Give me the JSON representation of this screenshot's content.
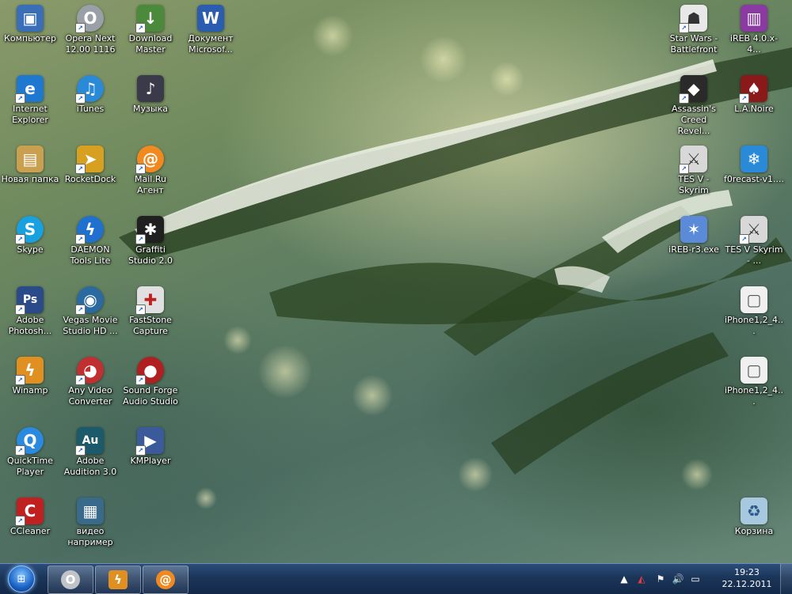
{
  "colors": {
    "taskbar": "#1b3558",
    "icon_label": "#ffffff"
  },
  "desktop_icons": {
    "kompyuter": {
      "label": "Компьютер",
      "icon": "computer-icon",
      "color": "#3a6fb8",
      "glyph": "▣"
    },
    "opera": {
      "label": "Opera Next 12.00 1116",
      "icon": "opera-icon",
      "color": "#9aa0a8",
      "glyph": "O"
    },
    "download_master": {
      "label": "Download Master",
      "icon": "download-master-icon",
      "color": "#4a8a3a",
      "glyph": "↓"
    },
    "document": {
      "label": "Документ Microsof...",
      "icon": "word-document-icon",
      "color": "#2a5db0",
      "glyph": "W"
    },
    "ie": {
      "label": "Internet Explorer",
      "icon": "internet-explorer-icon",
      "color": "#1f78d0",
      "glyph": "e"
    },
    "itunes": {
      "label": "iTunes",
      "icon": "itunes-icon",
      "color": "#2a8ad8",
      "glyph": "♫"
    },
    "muzyka": {
      "label": "Музыка",
      "icon": "music-folder-icon",
      "color": "#3a3a4a",
      "glyph": "♪"
    },
    "novaya_papka": {
      "label": "Новая папка",
      "icon": "folder-icon",
      "color": "#c8a050",
      "glyph": "▤"
    },
    "rocketdock": {
      "label": "RocketDock",
      "icon": "rocketdock-icon",
      "color": "#d8a020",
      "glyph": "➤"
    },
    "mailru": {
      "label": "Mail.Ru Агент",
      "icon": "mailru-agent-icon",
      "color": "#f08a20",
      "glyph": "@"
    },
    "skype": {
      "label": "Skype",
      "icon": "skype-icon",
      "color": "#18a0e0",
      "glyph": "S"
    },
    "daemon": {
      "label": "DAEMON Tools Lite",
      "icon": "daemon-tools-icon",
      "color": "#2070d0",
      "glyph": "ϟ"
    },
    "graffiti": {
      "label": "Graffiti Studio 2.0",
      "icon": "graffiti-studio-icon",
      "color": "#202020",
      "glyph": "✱"
    },
    "photoshop": {
      "label": "Adobe Photosh...",
      "icon": "photoshop-icon",
      "color": "#2a4a8a",
      "glyph": "Ps"
    },
    "vegas": {
      "label": "Vegas Movie Studio HD ...",
      "icon": "vegas-movie-studio-icon",
      "color": "#2a6aa0",
      "glyph": "◉"
    },
    "faststone": {
      "label": "FastStone Capture",
      "icon": "faststone-capture-icon",
      "color": "#e0e0e0",
      "glyph": "✚"
    },
    "winamp": {
      "label": "Winamp",
      "icon": "winamp-icon",
      "color": "#e09020",
      "glyph": "ϟ"
    },
    "anyvideo": {
      "label": "Any Video Converter",
      "icon": "any-video-converter-icon",
      "color": "#c03030",
      "glyph": "◕"
    },
    "soundforge": {
      "label": "Sound Forge Audio Studio",
      "icon": "sound-forge-icon",
      "color": "#b02020",
      "glyph": "●"
    },
    "quicktime": {
      "label": "QuickTime Player",
      "icon": "quicktime-icon",
      "color": "#2a8ae0",
      "glyph": "Q"
    },
    "audition": {
      "label": "Adobe Audition 3.0",
      "icon": "audition-icon",
      "color": "#1a5a6a",
      "glyph": "Au"
    },
    "kmplayer": {
      "label": "KMPlayer",
      "icon": "kmplayer-icon",
      "color": "#3a5a9a",
      "glyph": "▶"
    },
    "ccleaner": {
      "label": "CCleaner",
      "icon": "ccleaner-icon",
      "color": "#c02020",
      "glyph": "C"
    },
    "video": {
      "label": "видео например",
      "icon": "video-file-icon",
      "color": "#3a6a8a",
      "glyph": "▦"
    },
    "starwars": {
      "label": "Star Wars - Battlefront",
      "icon": "star-wars-icon",
      "color": "#e8e8e8",
      "glyph": "☗"
    },
    "ireb1": {
      "label": "iREB 4.0.x-4...",
      "icon": "winrar-archive-icon",
      "color": "#8a3aa0",
      "glyph": "▥"
    },
    "assassin": {
      "label": "Assassin's Creed Revel...",
      "icon": "assassins-creed-icon",
      "color": "#2a2a2a",
      "glyph": "◆"
    },
    "lanoire": {
      "label": "L.A.Noire",
      "icon": "la-noire-icon",
      "color": "#8a1a1a",
      "glyph": "♠"
    },
    "tes1": {
      "label": "TES V - Skyrim",
      "icon": "skyrim-icon",
      "color": "#d8d8d8",
      "glyph": "⚔"
    },
    "f0recast": {
      "label": "f0recast-v1....",
      "icon": "snowflake-icon",
      "color": "#2a8ad8",
      "glyph": "❄"
    },
    "ireb_r3": {
      "label": "iREB-r3.exe",
      "icon": "ireb-exe-icon",
      "color": "#5a8ad8",
      "glyph": "✶"
    },
    "tes2": {
      "label": "TES V Skyrim - ...",
      "icon": "skyrim-icon",
      "color": "#d8d8d8",
      "glyph": "⚔"
    },
    "iphone1": {
      "label": "iPhone1,2_4...",
      "icon": "ipsw-file-icon",
      "color": "#f0f0f0",
      "glyph": "▢"
    },
    "iphone2": {
      "label": "iPhone1,2_4...",
      "icon": "ipsw-file-icon",
      "color": "#f0f0f0",
      "glyph": "▢"
    },
    "korzina": {
      "label": "Корзина",
      "icon": "recycle-bin-icon",
      "color": "#a8c8e0",
      "glyph": "♻"
    }
  },
  "taskbar": {
    "pinned": [
      {
        "icon": "opera-icon",
        "glyph": "O",
        "color": "#c0c4c8"
      },
      {
        "icon": "winamp-icon",
        "glyph": "ϟ",
        "color": "#e09020"
      },
      {
        "icon": "mailru-agent-icon",
        "glyph": "@",
        "color": "#f08a20"
      }
    ],
    "tray": {
      "time": "19:23",
      "date": "22.12.2011"
    }
  }
}
